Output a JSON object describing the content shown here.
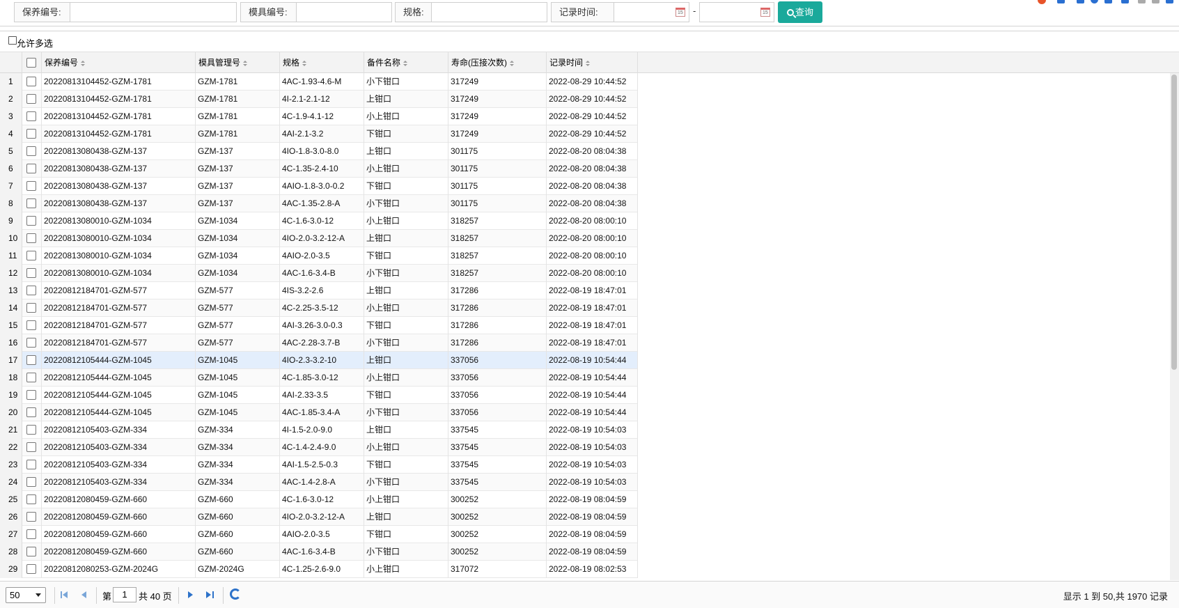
{
  "filters": {
    "maint_no_label": "保养编号:",
    "mold_no_label": "模具编号:",
    "spec_label": "规格:",
    "record_time_label": "记录时间:",
    "date_separator": "-",
    "calendar_text": "15",
    "search_label": "查询"
  },
  "grid": {
    "multi_select_label": "允许多选",
    "columns": [
      "保养编号",
      "模具管理号",
      "规格",
      "备件名称",
      "寿命(压接次数)",
      "记录时间"
    ],
    "rows": [
      [
        "1",
        "20220813104452-GZM-1781",
        "GZM-1781",
        "4AC-1.93-4.6-M",
        "小下钳口",
        "317249",
        "2022-08-29 10:44:52"
      ],
      [
        "2",
        "20220813104452-GZM-1781",
        "GZM-1781",
        "4I-2.1-2.1-12",
        "上钳口",
        "317249",
        "2022-08-29 10:44:52"
      ],
      [
        "3",
        "20220813104452-GZM-1781",
        "GZM-1781",
        "4C-1.9-4.1-12",
        "小上钳口",
        "317249",
        "2022-08-29 10:44:52"
      ],
      [
        "4",
        "20220813104452-GZM-1781",
        "GZM-1781",
        "4AI-2.1-3.2",
        "下钳口",
        "317249",
        "2022-08-29 10:44:52"
      ],
      [
        "5",
        "20220813080438-GZM-137",
        "GZM-137",
        "4IO-1.8-3.0-8.0",
        "上钳口",
        "301175",
        "2022-08-20 08:04:38"
      ],
      [
        "6",
        "20220813080438-GZM-137",
        "GZM-137",
        "4C-1.35-2.4-10",
        "小上钳口",
        "301175",
        "2022-08-20 08:04:38"
      ],
      [
        "7",
        "20220813080438-GZM-137",
        "GZM-137",
        "4AIO-1.8-3.0-0.2",
        "下钳口",
        "301175",
        "2022-08-20 08:04:38"
      ],
      [
        "8",
        "20220813080438-GZM-137",
        "GZM-137",
        "4AC-1.35-2.8-A",
        "小下钳口",
        "301175",
        "2022-08-20 08:04:38"
      ],
      [
        "9",
        "20220813080010-GZM-1034",
        "GZM-1034",
        "4C-1.6-3.0-12",
        "小上钳口",
        "318257",
        "2022-08-20 08:00:10"
      ],
      [
        "10",
        "20220813080010-GZM-1034",
        "GZM-1034",
        "4IO-2.0-3.2-12-A",
        "上钳口",
        "318257",
        "2022-08-20 08:00:10"
      ],
      [
        "11",
        "20220813080010-GZM-1034",
        "GZM-1034",
        "4AIO-2.0-3.5",
        "下钳口",
        "318257",
        "2022-08-20 08:00:10"
      ],
      [
        "12",
        "20220813080010-GZM-1034",
        "GZM-1034",
        "4AC-1.6-3.4-B",
        "小下钳口",
        "318257",
        "2022-08-20 08:00:10"
      ],
      [
        "13",
        "20220812184701-GZM-577",
        "GZM-577",
        "4IS-3.2-2.6",
        "上钳口",
        "317286",
        "2022-08-19 18:47:01"
      ],
      [
        "14",
        "20220812184701-GZM-577",
        "GZM-577",
        "4C-2.25-3.5-12",
        "小上钳口",
        "317286",
        "2022-08-19 18:47:01"
      ],
      [
        "15",
        "20220812184701-GZM-577",
        "GZM-577",
        "4AI-3.26-3.0-0.3",
        "下钳口",
        "317286",
        "2022-08-19 18:47:01"
      ],
      [
        "16",
        "20220812184701-GZM-577",
        "GZM-577",
        "4AC-2.28-3.7-B",
        "小下钳口",
        "317286",
        "2022-08-19 18:47:01"
      ],
      [
        "17",
        "20220812105444-GZM-1045",
        "GZM-1045",
        "4IO-2.3-3.2-10",
        "上钳口",
        "337056",
        "2022-08-19 10:54:44"
      ],
      [
        "18",
        "20220812105444-GZM-1045",
        "GZM-1045",
        "4C-1.85-3.0-12",
        "小上钳口",
        "337056",
        "2022-08-19 10:54:44"
      ],
      [
        "19",
        "20220812105444-GZM-1045",
        "GZM-1045",
        "4AI-2.33-3.5",
        "下钳口",
        "337056",
        "2022-08-19 10:54:44"
      ],
      [
        "20",
        "20220812105444-GZM-1045",
        "GZM-1045",
        "4AC-1.85-3.4-A",
        "小下钳口",
        "337056",
        "2022-08-19 10:54:44"
      ],
      [
        "21",
        "20220812105403-GZM-334",
        "GZM-334",
        "4I-1.5-2.0-9.0",
        "上钳口",
        "337545",
        "2022-08-19 10:54:03"
      ],
      [
        "22",
        "20220812105403-GZM-334",
        "GZM-334",
        "4C-1.4-2.4-9.0",
        "小上钳口",
        "337545",
        "2022-08-19 10:54:03"
      ],
      [
        "23",
        "20220812105403-GZM-334",
        "GZM-334",
        "4AI-1.5-2.5-0.3",
        "下钳口",
        "337545",
        "2022-08-19 10:54:03"
      ],
      [
        "24",
        "20220812105403-GZM-334",
        "GZM-334",
        "4AC-1.4-2.8-A",
        "小下钳口",
        "337545",
        "2022-08-19 10:54:03"
      ],
      [
        "25",
        "20220812080459-GZM-660",
        "GZM-660",
        "4C-1.6-3.0-12",
        "小上钳口",
        "300252",
        "2022-08-19 08:04:59"
      ],
      [
        "26",
        "20220812080459-GZM-660",
        "GZM-660",
        "4IO-2.0-3.2-12-A",
        "上钳口",
        "300252",
        "2022-08-19 08:04:59"
      ],
      [
        "27",
        "20220812080459-GZM-660",
        "GZM-660",
        "4AIO-2.0-3.5",
        "下钳口",
        "300252",
        "2022-08-19 08:04:59"
      ],
      [
        "28",
        "20220812080459-GZM-660",
        "GZM-660",
        "4AC-1.6-3.4-B",
        "小下钳口",
        "300252",
        "2022-08-19 08:04:59"
      ],
      [
        "29",
        "20220812080253-GZM-2024G",
        "GZM-2024G",
        "4C-1.25-2.6-9.0",
        "小上钳口",
        "317072",
        "2022-08-19 08:02:53"
      ]
    ],
    "selected_row": 17
  },
  "pager": {
    "page_size": "50",
    "page_prefix": "第",
    "current_page": "1",
    "total_pages_text": "共 40 页",
    "summary": "显示 1 到 50,共 1970 记录"
  },
  "colors": {
    "search_button": "#1aa99b",
    "selected_row": "#e3eefc",
    "pager_icon": "#2d72c9"
  }
}
